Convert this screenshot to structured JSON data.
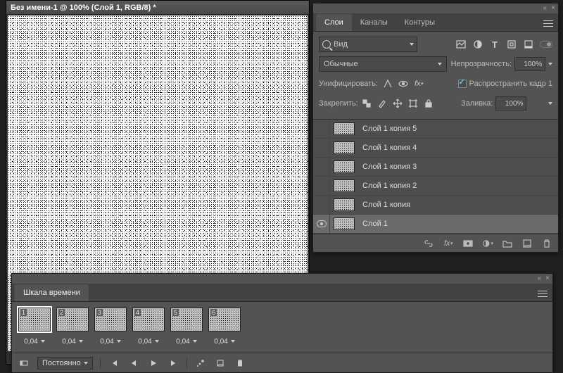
{
  "document": {
    "title": "Без имени-1 @ 100% (Слой 1, RGB/8) *",
    "zoom": "1"
  },
  "layers_panel": {
    "tabs": [
      "Слои",
      "Каналы",
      "Контуры"
    ],
    "active_tab": 0,
    "search_label": "Вид",
    "filter_icons": [
      "image-filter-icon",
      "adjustment-filter-icon",
      "type-filter-icon",
      "shape-filter-icon",
      "smart-filter-icon"
    ],
    "blend_mode": "Обычные",
    "opacity_label": "Непрозрачность:",
    "opacity_value": "100%",
    "unify_label": "Унифицировать:",
    "propagate_label": "Распространить кадр 1",
    "propagate_checked": true,
    "lock_label": "Закрепить:",
    "fill_label": "Заливка:",
    "fill_value": "100%",
    "layers": [
      {
        "name": "Слой 1 копия 5",
        "visible": false,
        "selected": false
      },
      {
        "name": "Слой 1 копия 4",
        "visible": false,
        "selected": false
      },
      {
        "name": "Слой 1 копия 3",
        "visible": false,
        "selected": false
      },
      {
        "name": "Слой 1 копия 2",
        "visible": false,
        "selected": false
      },
      {
        "name": "Слой 1 копия",
        "visible": false,
        "selected": false
      },
      {
        "name": "Слой 1",
        "visible": true,
        "selected": true
      }
    ],
    "footer_icons": [
      "link-icon",
      "fx-icon",
      "mask-icon",
      "adjustment-icon",
      "group-icon",
      "new-layer-icon",
      "trash-icon"
    ]
  },
  "timeline_panel": {
    "tab": "Шкала времени",
    "frames": [
      {
        "num": "1",
        "delay": "0,04",
        "selected": true
      },
      {
        "num": "2",
        "delay": "0,04",
        "selected": false
      },
      {
        "num": "3",
        "delay": "0,04",
        "selected": false
      },
      {
        "num": "4",
        "delay": "0,04",
        "selected": false
      },
      {
        "num": "5",
        "delay": "0,04",
        "selected": false
      },
      {
        "num": "6",
        "delay": "0,04",
        "selected": false
      }
    ],
    "loop_mode": "Постоянно",
    "playback_icons": [
      "first-frame-icon",
      "prev-frame-icon",
      "play-icon",
      "next-frame-icon",
      "tween-icon",
      "duplicate-frame-icon",
      "delete-frame-icon"
    ]
  }
}
